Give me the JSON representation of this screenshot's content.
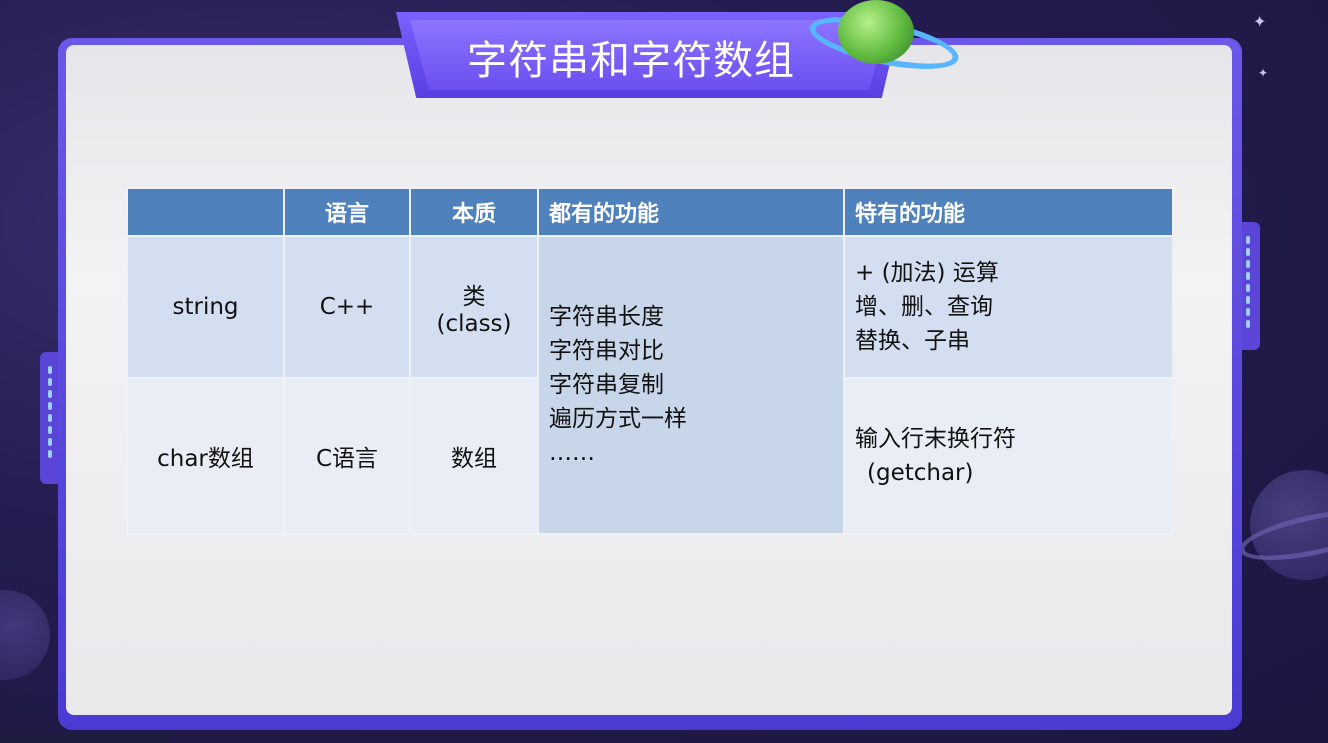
{
  "slide": {
    "title": "字符串和字符数组"
  },
  "table": {
    "headers": [
      "",
      "语言",
      "本质",
      "都有的功能",
      "特有的功能"
    ],
    "rows": [
      {
        "name": "string",
        "language": "C++",
        "essence_line1": "类",
        "essence_line2": "(class)",
        "special": [
          "+ (加法) 运算",
          "增、删、查询",
          "替换、子串"
        ]
      },
      {
        "name": "char数组",
        "language": "C语言",
        "essence_line1": "数组",
        "essence_line2": "",
        "special": [
          "输入行末换行符",
          "(getchar)"
        ]
      }
    ],
    "common": [
      "字符串长度",
      "字符串对比",
      "字符串复制",
      "遍历方式一样",
      "……"
    ]
  },
  "colors": {
    "header_bg": "#4f81bd",
    "row1_bg": "#d3dff0",
    "row2_bg": "#e8edf6",
    "frame": "#5a45d6"
  }
}
